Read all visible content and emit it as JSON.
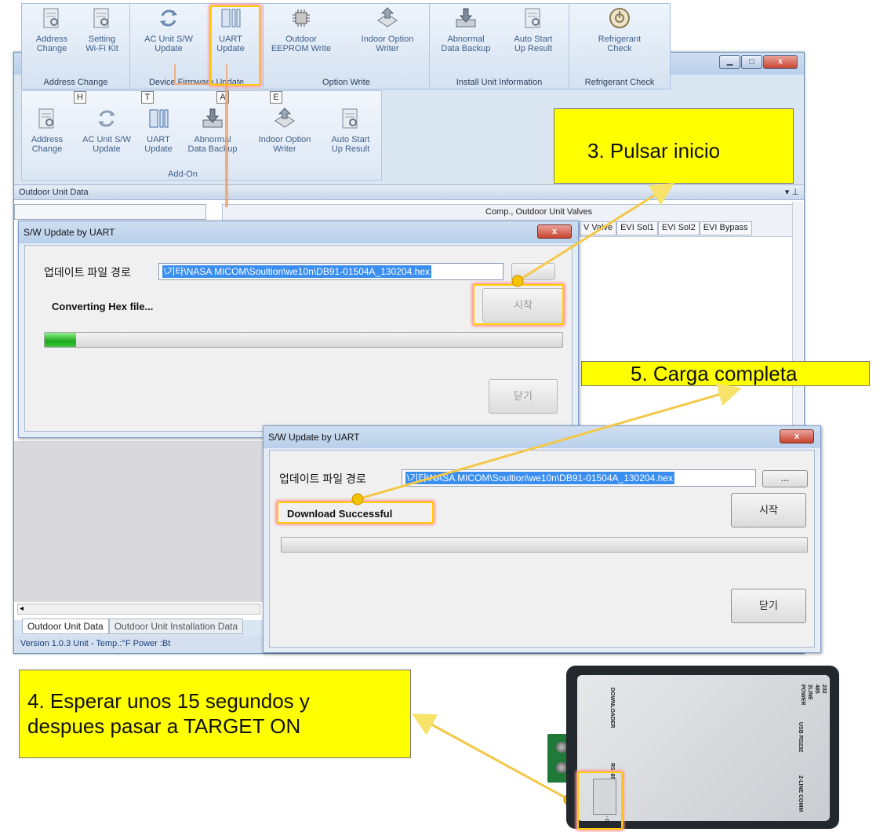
{
  "colors": {
    "callout_bg": "#ffff00",
    "highlight": "#ffcc00",
    "progress": "#1aa81a",
    "selection": "#3a8ef0"
  },
  "ribbon": {
    "groups": [
      {
        "label": "Address Change",
        "items": [
          {
            "line1": "Address",
            "line2": "Change",
            "icon": "document-search-icon"
          },
          {
            "line1": "Setting",
            "line2": "Wi-Fi Kit",
            "icon": "document-search-icon"
          }
        ]
      },
      {
        "label": "Device Firmware Update",
        "items": [
          {
            "line1": "AC Unit S/W",
            "line2": "Update",
            "icon": "refresh-icon"
          },
          {
            "line1": "UART",
            "line2": "Update",
            "icon": "uart-icon"
          }
        ]
      },
      {
        "label": "Option Write",
        "items": [
          {
            "line1": "Outdoor",
            "line2": "EEPROM Write",
            "icon": "chip-icon"
          },
          {
            "line1": "Indoor Option",
            "line2": "Writer",
            "icon": "upload-icon"
          }
        ]
      },
      {
        "label": "Install Unit Information",
        "items": [
          {
            "line1": "Abnormal",
            "line2": "Data Backup",
            "icon": "download-tray-icon"
          },
          {
            "line1": "Auto Start",
            "line2": "Up Result",
            "icon": "document-search-icon"
          }
        ]
      },
      {
        "label": "Refrigerant Check",
        "items": [
          {
            "line1": "Refrigerant",
            "line2": "Check",
            "icon": "gauge-icon"
          }
        ]
      }
    ],
    "keytips": [
      "H",
      "T",
      "A",
      "E"
    ],
    "sub_items": [
      {
        "line1": "Address",
        "line2": "Change"
      },
      {
        "line1": "AC Unit S/W",
        "line2": "Update"
      },
      {
        "line1": "UART",
        "line2": "Update"
      },
      {
        "line1": "Abnormal",
        "line2": "Data Backup"
      },
      {
        "line1": "Indoor Option",
        "line2": "Writer"
      },
      {
        "line1": "Auto Start",
        "line2": "Up Result"
      }
    ],
    "sub_group_label": "Add-On"
  },
  "panel": {
    "title": "Outdoor Unit Data",
    "pin": "▾ ⊥",
    "grid_caption": "Comp., Outdoor Unit Valves",
    "columns": [
      "V Valve",
      "EVI Sol1",
      "EVI Sol2",
      "EVI Bypass"
    ],
    "tabs": [
      "Outdoor Unit Data",
      "Outdoor Unit Installation Data"
    ],
    "status": "Version 1.0.3          Unit - Temp.:°F  Power :Bt"
  },
  "dialog1": {
    "title": "S/W Update by UART",
    "path_label": "업데이트 파일 경로",
    "path_value": "\\기타\\NASA MICOM\\Soultion\\we10n\\DB91-01504A_130204.hex",
    "start": "시작",
    "status": "Converting Hex file...",
    "progress": 0.06,
    "close": "닫기"
  },
  "dialog2": {
    "title": "S/W Update by UART",
    "path_label": "업데이트 파일 경로",
    "path_value": "\\기타\\NASA MICOM\\Soultion\\we10n\\DB91-01504A_130204.hex",
    "browse": "...",
    "start": "시작",
    "status": "Download Successful",
    "progress": 0,
    "close": "닫기"
  },
  "callouts": {
    "step3": "3. Pulsar inicio",
    "step5": "5. Carga completa",
    "step4": "4. Esperar unos 15 segundos y\ndespues pasar a     TARGET ON"
  },
  "device": {
    "labels": [
      "DOWNLOADER",
      "RS485",
      "TARGET OFF - ON",
      "USB RS232",
      "2-LINE COMM",
      "232",
      "485",
      "2LINE",
      "POWER"
    ]
  }
}
